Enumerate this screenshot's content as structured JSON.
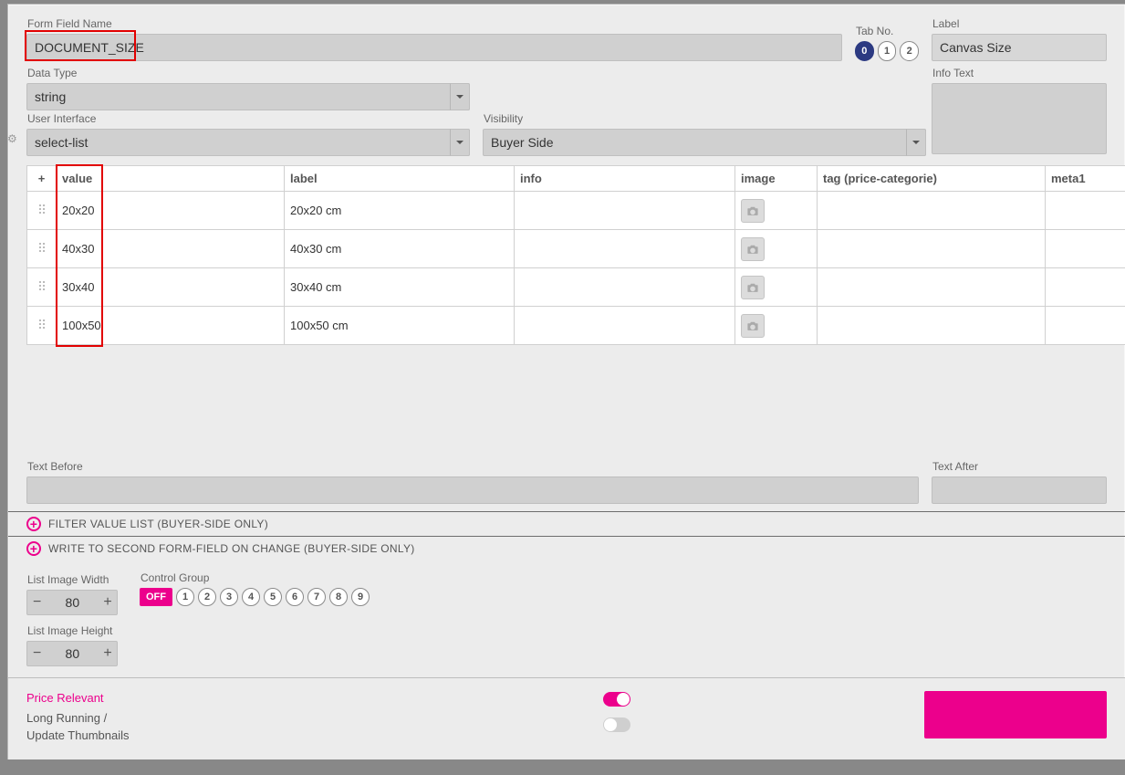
{
  "header": {
    "form_field_name_label": "Form Field Name",
    "form_field_name_value": "DOCUMENT_SIZE",
    "tab_no_label": "Tab No.",
    "tab_options": [
      "0",
      "1",
      "2"
    ],
    "tab_active_index": 0,
    "label_label": "Label",
    "label_value": "Canvas Size",
    "data_type_label": "Data Type",
    "data_type_value": "string",
    "info_text_label": "Info Text",
    "user_interface_label": "User Interface",
    "user_interface_value": "select-list",
    "visibility_label": "Visibility",
    "visibility_value": "Buyer Side"
  },
  "table": {
    "add_header": "+",
    "headers": {
      "value": "value",
      "label": "label",
      "info": "info",
      "image": "image",
      "tag": "tag (price-categorie)",
      "meta1": "meta1"
    },
    "rows": [
      {
        "value": "20x20",
        "label": "20x20 cm",
        "info": "",
        "tag": "",
        "meta1": ""
      },
      {
        "value": "40x30",
        "label": "40x30 cm",
        "info": "",
        "tag": "",
        "meta1": ""
      },
      {
        "value": "30x40",
        "label": "30x40 cm",
        "info": "",
        "tag": "",
        "meta1": ""
      },
      {
        "value": "100x50",
        "label": "100x50 cm",
        "info": "",
        "tag": "",
        "meta1": ""
      }
    ]
  },
  "text_before_label": "Text Before",
  "text_after_label": "Text After",
  "exp": {
    "filter": "FILTER VALUE LIST (BUYER-SIDE ONLY)",
    "write2": "WRITE TO SECOND FORM-FIELD ON CHANGE (BUYER-SIDE ONLY)"
  },
  "list_image": {
    "width_label": "List Image Width",
    "width_value": "80",
    "height_label": "List Image Height",
    "height_value": "80"
  },
  "control_group": {
    "label": "Control Group",
    "off": "OFF",
    "options": [
      "1",
      "2",
      "3",
      "4",
      "5",
      "6",
      "7",
      "8",
      "9"
    ]
  },
  "footer": {
    "price_relevant": "Price Relevant",
    "long_running_1": "Long Running /",
    "long_running_2": "Update Thumbnails",
    "price_relevant_on": true,
    "long_running_on": false
  }
}
